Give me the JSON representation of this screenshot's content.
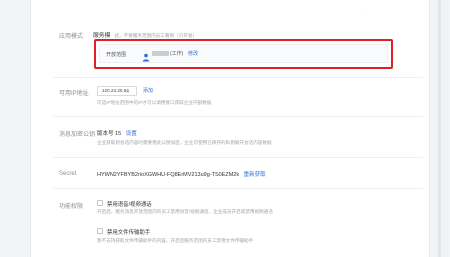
{
  "app_mode": {
    "label": "应用模式",
    "title": "服务模",
    "subtitle": "式，不要服务范围内员工看到（只开发）"
  },
  "scope": {
    "label": "开放范围",
    "dept": "(工作)",
    "edit": "修改"
  },
  "ip_whitelist": {
    "label": "可用IP地址",
    "value": "120.24.20.54",
    "add": "添加",
    "desc": "可选IP地址范围中的IP才可以调用接口获取企业内部数据"
  },
  "public_key": {
    "label": "消息加密公钥",
    "version": "版本号 15",
    "set": "设置",
    "desc": "企业获取到会话内容时需要用此公钥加密，企业可使用已保存的私钥解开会话内容数据"
  },
  "secret": {
    "label": "Secret",
    "value": "HYWN2YFBYB2rioXGWHU-FQ8ErMV213u9g-TS0EZM2k",
    "refresh": "重新获取"
  },
  "features": {
    "label": "功能权限",
    "items": [
      {
        "title": "禁用语音/视频通话",
        "desc": "开启后，服务消息开放范围内的员工禁用语音/视频通话，企业成员开启或禁用视频通话"
      },
      {
        "title": "禁用文件传输助手",
        "desc": "暂不支持获取文件传输助手的内容，开启后服务范围内员工禁用文件传输助手"
      }
    ]
  },
  "colors": {
    "accent": "#2f6fd6",
    "highlight": "#e21f26"
  },
  "icons": {
    "person": "person-icon",
    "dropdown": "chevron-down-icon"
  }
}
